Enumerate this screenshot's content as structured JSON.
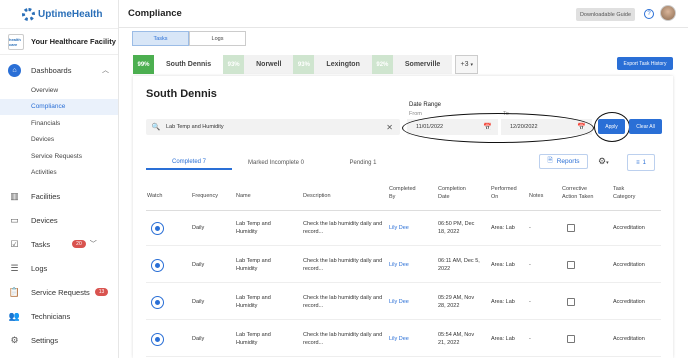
{
  "brand": {
    "name": "UptimeHealth",
    "facility": "Your Healthcare Facility",
    "facility_logo_text": "health care"
  },
  "header": {
    "title": "Compliance",
    "download_guide": "Downloadable Guide",
    "help": "?"
  },
  "sidebar": {
    "dashboards": "Dashboards",
    "sub_items": [
      "Overview",
      "Compliance",
      "Financials",
      "Devices",
      "Service Requests",
      "Activities"
    ],
    "facilities": "Facilities",
    "devices": "Devices",
    "tasks": "Tasks",
    "tasks_badge": "20",
    "logs": "Logs",
    "service_requests": "Service Requests",
    "service_requests_badge": "13",
    "technicians": "Technicians",
    "settings": "Settings"
  },
  "tabs": [
    "Tasks",
    "Logs"
  ],
  "locations": [
    {
      "pct": "99%",
      "name": "South Dennis"
    },
    {
      "pct": "93%",
      "name": "Norwell"
    },
    {
      "pct": "93%",
      "name": "Lexington"
    },
    {
      "pct": "92%",
      "name": "Somerville"
    }
  ],
  "more_locations": "+3",
  "export_btn": "Export Task History",
  "panel": {
    "title": "South Dennis",
    "search_value": "Lab Temp and Humidity",
    "date_range_label": "Date Range",
    "from_label": "From",
    "to_label": "To",
    "from_date": "11/01/2022",
    "to_date": "12/20/2022",
    "apply": "Apply",
    "clear_all": "Clear All",
    "subtabs": [
      "Completed 7",
      "Marked Incomplete 0",
      "Pending 1"
    ],
    "reports": "Reports",
    "filter_count": "1"
  },
  "table": {
    "headers": {
      "watch": "Watch",
      "frequency": "Frequency",
      "name": "Name",
      "description": "Description",
      "completed_by_1": "Completed",
      "completed_by_2": "By",
      "completion_date_1": "Completion",
      "completion_date_2": "Date",
      "performed_on_1": "Performed",
      "performed_on_2": "On",
      "notes": "Notes",
      "corrective_1": "Corrective",
      "corrective_2": "Action Taken",
      "category_1": "Task",
      "category_2": "Category"
    },
    "rows": [
      {
        "frequency": "Daily",
        "name_1": "Lab Temp and",
        "name_2": "Humidity",
        "desc_1": "Check the lab humidity daily and",
        "desc_2": "record...",
        "completed_by": "Lily Dee",
        "date_1": "06:50 PM, Dec",
        "date_2": "18, 2022",
        "performed_on": "Area: Lab",
        "notes": "-",
        "category": "Accreditation"
      },
      {
        "frequency": "Daily",
        "name_1": "Lab Temp and",
        "name_2": "Humidity",
        "desc_1": "Check the lab humidity daily and",
        "desc_2": "record...",
        "completed_by": "Lily Dee",
        "date_1": "06:11 AM, Dec 5,",
        "date_2": "2022",
        "performed_on": "Area: Lab",
        "notes": "-",
        "category": "Accreditation"
      },
      {
        "frequency": "Daily",
        "name_1": "Lab Temp and",
        "name_2": "Humidity",
        "desc_1": "Check the lab humidity daily and",
        "desc_2": "record...",
        "completed_by": "Lily Dee",
        "date_1": "05:29 AM, Nov",
        "date_2": "28, 2022",
        "performed_on": "Area: Lab",
        "notes": "-",
        "category": "Accreditation"
      },
      {
        "frequency": "Daily",
        "name_1": "Lab Temp and",
        "name_2": "Humidity",
        "desc_1": "Check the lab humidity daily and",
        "desc_2": "record...",
        "completed_by": "Lily Dee",
        "date_1": "05:54 AM, Nov",
        "date_2": "21, 2022",
        "performed_on": "Area: Lab",
        "notes": "-",
        "category": "Accreditation"
      }
    ]
  },
  "icons": {
    "dashboards": "home-icon",
    "facilities": "building-icon",
    "devices": "monitor-icon",
    "tasks": "checklist-icon",
    "logs": "list-icon",
    "service_requests": "clipboard-icon",
    "technicians": "people-icon",
    "settings": "gear-icon"
  },
  "colors": {
    "accent": "#2a6fd6",
    "success": "#4caf50",
    "danger": "#d9534f"
  }
}
